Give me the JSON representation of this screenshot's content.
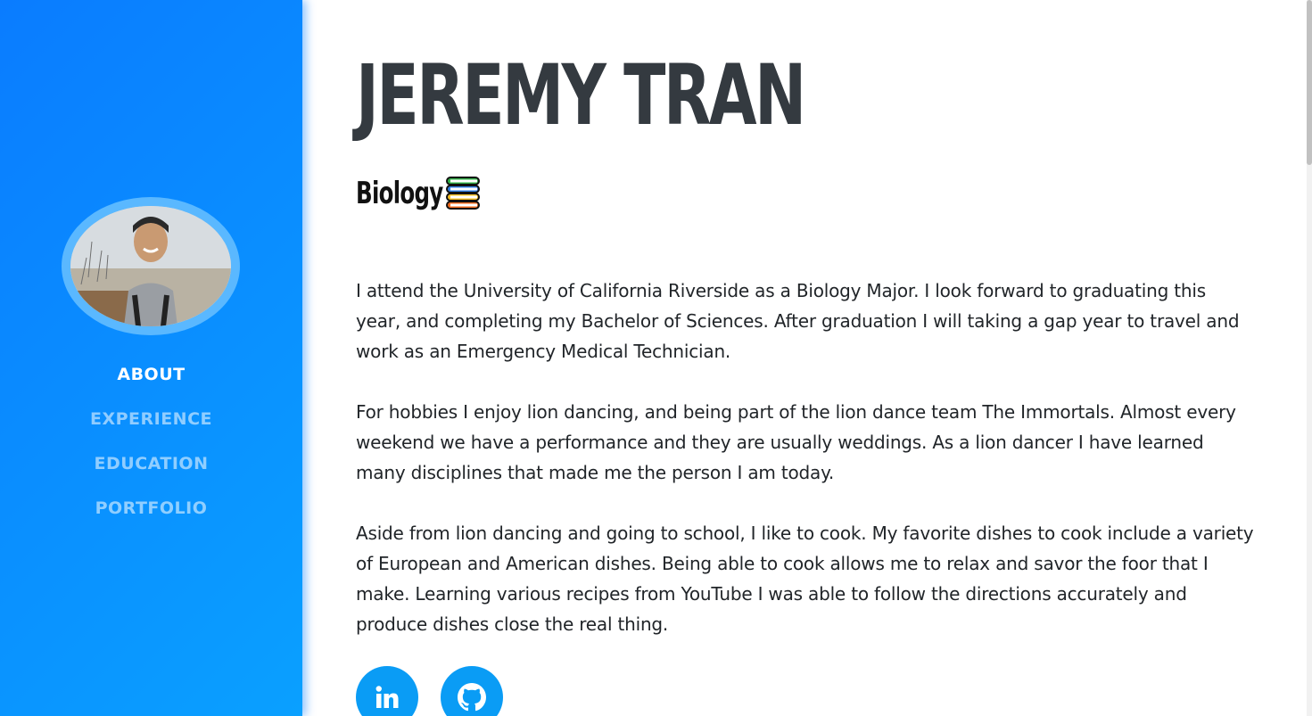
{
  "sidebar": {
    "nav": [
      {
        "label": "ABOUT",
        "active": true
      },
      {
        "label": "EXPERIENCE",
        "active": false
      },
      {
        "label": "EDUCATION",
        "active": false
      },
      {
        "label": "PORTFOLIO",
        "active": false
      }
    ]
  },
  "header": {
    "name": "JEREMY TRAN",
    "subtitle": "Biology",
    "subtitle_icon": "books-icon"
  },
  "about": {
    "paragraphs": [
      "I attend the University of California Riverside as a Biology Major. I look forward to graduating this year, and completing my Bachelor of Sciences. After graduation I will taking a gap year to travel and work as an Emergency Medical Technician.",
      "For hobbies I enjoy lion dancing, and being part of the lion dance team The Immortals. Almost every weekend we have a performance and they are usually weddings. As a lion dancer I have learned many disciplines that made me the person I am today.",
      "Aside from lion dancing and going to school, I like to cook. My favorite dishes to cook include a variety of European and American dishes. Being able to cook allows me to relax and savor the foor that I make. Learning various recipes from YouTube I was able to follow the directions accurately and produce dishes close the real thing."
    ]
  },
  "socials": [
    {
      "icon": "linkedin-icon"
    },
    {
      "icon": "github-icon"
    }
  ],
  "colors": {
    "sidebar_gradient_start": "#0a7cff",
    "sidebar_gradient_end": "#0aa0ff",
    "accent": "#0a9cf5",
    "name_text": "#343a40",
    "body_text": "#212529"
  }
}
